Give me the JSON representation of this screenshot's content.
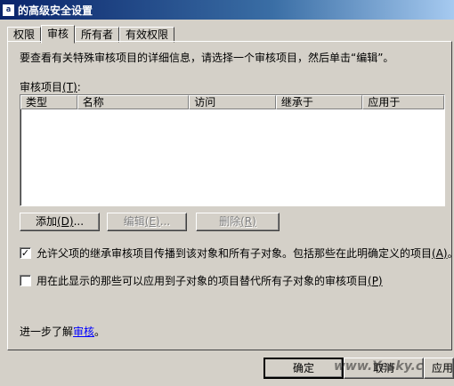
{
  "window": {
    "title": "的高级安全设置",
    "icon_char": "a"
  },
  "tabs": [
    {
      "label": "权限",
      "active": false
    },
    {
      "label": "审核",
      "active": true
    },
    {
      "label": "所有者",
      "active": false
    },
    {
      "label": "有效权限",
      "active": false
    }
  ],
  "description": "要查看有关特殊审核项目的详细信息，请选择一个审核项目，然后单击“编辑”。",
  "entries": {
    "label": "审核项目",
    "label_key": "(T)",
    "label_colon": ":",
    "columns": [
      "类型",
      "名称",
      "访问",
      "继承于",
      "应用于"
    ],
    "rows": []
  },
  "buttons": {
    "add": {
      "label": "添加",
      "key": "(D)",
      "suffix": "..."
    },
    "edit": {
      "label": "编辑",
      "key": "(E)",
      "suffix": "..."
    },
    "delete": {
      "label": "删除",
      "key": "(R)",
      "suffix": ""
    }
  },
  "options": {
    "inherit": {
      "checked": true,
      "text": "允许父项的继承审核项目传播到该对象和所有子对象。包括那些在此明确定义的项目",
      "key": "(A)",
      "suffix": "。"
    },
    "replace": {
      "checked": false,
      "text": "用在此显示的那些可以应用到子对象的项目替代所有子对象的审核项目",
      "key": "(P)"
    }
  },
  "learn_more": {
    "prefix": "进一步了解",
    "link": "审核",
    "suffix": "。"
  },
  "dialog_buttons": {
    "ok": "确定",
    "cancel": "取消",
    "apply": "应用"
  },
  "watermark": "www.Yesky.c"
}
